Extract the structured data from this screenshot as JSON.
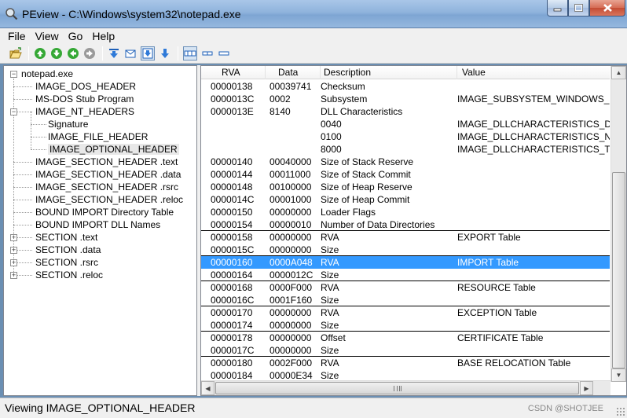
{
  "window": {
    "title": "PEview - C:\\Windows\\system32\\notepad.exe"
  },
  "menu": [
    "File",
    "View",
    "Go",
    "Help"
  ],
  "toolbar": {
    "icons": [
      "open-icon",
      "back-icon",
      "forward-icon",
      "up-icon",
      "refresh-icon",
      "view1-icon",
      "view2-icon",
      "view3-icon",
      "view4-icon",
      "mode1-icon",
      "mode2-icon",
      "mode3-icon"
    ]
  },
  "tree": {
    "root": "notepad.exe",
    "nodes": [
      {
        "label": "IMAGE_DOS_HEADER",
        "level": 1
      },
      {
        "label": "MS-DOS Stub Program",
        "level": 1
      },
      {
        "label": "IMAGE_NT_HEADERS",
        "level": 1,
        "expanded": true
      },
      {
        "label": "Signature",
        "level": 2
      },
      {
        "label": "IMAGE_FILE_HEADER",
        "level": 2
      },
      {
        "label": "IMAGE_OPTIONAL_HEADER",
        "level": 2,
        "selected": true
      },
      {
        "label": "IMAGE_SECTION_HEADER .text",
        "level": 1
      },
      {
        "label": "IMAGE_SECTION_HEADER .data",
        "level": 1
      },
      {
        "label": "IMAGE_SECTION_HEADER .rsrc",
        "level": 1
      },
      {
        "label": "IMAGE_SECTION_HEADER .reloc",
        "level": 1
      },
      {
        "label": "BOUND IMPORT Directory Table",
        "level": 1
      },
      {
        "label": "BOUND IMPORT DLL Names",
        "level": 1
      },
      {
        "label": "SECTION .text",
        "level": 1,
        "collapsed": true
      },
      {
        "label": "SECTION .data",
        "level": 1,
        "collapsed": true
      },
      {
        "label": "SECTION .rsrc",
        "level": 1,
        "collapsed": true
      },
      {
        "label": "SECTION .reloc",
        "level": 1,
        "collapsed": true
      }
    ]
  },
  "list": {
    "columns": [
      "RVA",
      "Data",
      "Description",
      "Value"
    ],
    "rows": [
      {
        "rva": "00000138",
        "data": "00039741",
        "desc": "Checksum",
        "value": ""
      },
      {
        "rva": "0000013C",
        "data": "0002",
        "desc": "Subsystem",
        "value": "IMAGE_SUBSYSTEM_WINDOWS_G"
      },
      {
        "rva": "0000013E",
        "data": "8140",
        "desc": "DLL Characteristics",
        "value": ""
      },
      {
        "rva": "",
        "data": "",
        "desc": "0040",
        "value": "IMAGE_DLLCHARACTERISTICS_DY"
      },
      {
        "rva": "",
        "data": "",
        "desc": "0100",
        "value": "IMAGE_DLLCHARACTERISTICS_NX"
      },
      {
        "rva": "",
        "data": "",
        "desc": "8000",
        "value": "IMAGE_DLLCHARACTERISTICS_TE"
      },
      {
        "rva": "00000140",
        "data": "00040000",
        "desc": "Size of Stack Reserve",
        "value": ""
      },
      {
        "rva": "00000144",
        "data": "00011000",
        "desc": "Size of Stack Commit",
        "value": ""
      },
      {
        "rva": "00000148",
        "data": "00100000",
        "desc": "Size of Heap Reserve",
        "value": ""
      },
      {
        "rva": "0000014C",
        "data": "00001000",
        "desc": "Size of Heap Commit",
        "value": ""
      },
      {
        "rva": "00000150",
        "data": "00000000",
        "desc": "Loader Flags",
        "value": ""
      },
      {
        "rva": "00000154",
        "data": "00000010",
        "desc": "Number of Data Directories",
        "value": ""
      },
      {
        "rva": "00000158",
        "data": "00000000",
        "desc": "RVA",
        "value": "EXPORT Table",
        "group_start": true
      },
      {
        "rva": "0000015C",
        "data": "00000000",
        "desc": "Size",
        "value": ""
      },
      {
        "rva": "00000160",
        "data": "0000A048",
        "desc": "RVA",
        "value": "IMPORT Table",
        "group_start": true,
        "selected": true
      },
      {
        "rva": "00000164",
        "data": "0000012C",
        "desc": "Size",
        "value": ""
      },
      {
        "rva": "00000168",
        "data": "0000F000",
        "desc": "RVA",
        "value": "RESOURCE Table",
        "group_start": true
      },
      {
        "rva": "0000016C",
        "data": "0001F160",
        "desc": "Size",
        "value": ""
      },
      {
        "rva": "00000170",
        "data": "00000000",
        "desc": "RVA",
        "value": "EXCEPTION Table",
        "group_start": true
      },
      {
        "rva": "00000174",
        "data": "00000000",
        "desc": "Size",
        "value": ""
      },
      {
        "rva": "00000178",
        "data": "00000000",
        "desc": "Offset",
        "value": "CERTIFICATE Table",
        "group_start": true
      },
      {
        "rva": "0000017C",
        "data": "00000000",
        "desc": "Size",
        "value": ""
      },
      {
        "rva": "00000180",
        "data": "0002F000",
        "desc": "RVA",
        "value": "BASE RELOCATION Table",
        "group_start": true
      },
      {
        "rva": "00000184",
        "data": "00000E34",
        "desc": "Size",
        "value": ""
      }
    ]
  },
  "status": {
    "text": "Viewing IMAGE_OPTIONAL_HEADER"
  },
  "watermark": "CSDN @SHOTJEE",
  "colors": {
    "selection": "#3399ff",
    "titlebar": "#8fb3dc"
  }
}
